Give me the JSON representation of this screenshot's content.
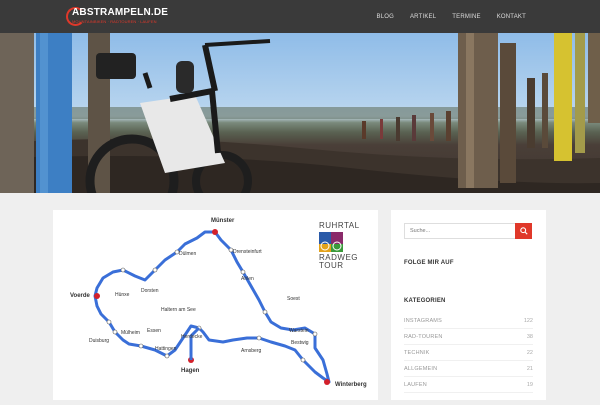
{
  "header": {
    "site_title": "ABSTRAMPELN.DE",
    "site_tagline": "MOUNTAINBIKEN · RADTOUREN · LAUFEN",
    "nav": [
      {
        "label": "BLOG"
      },
      {
        "label": "ARTIKEL"
      },
      {
        "label": "TERMINE"
      },
      {
        "label": "KONTAKT"
      }
    ]
  },
  "colors": {
    "accent": "#e0382a",
    "header_bg": "#3a3a3a",
    "page_bg": "#efefef",
    "route": "#3a6fd8"
  },
  "map": {
    "logo_lines": [
      "RUHRTAL",
      "RADWEG",
      "TOUR"
    ],
    "places": {
      "muenster": "Münster",
      "dolmen": "Dülmen",
      "drensteinfurt": "Drensteinfurt",
      "haltern": "Haltern am See",
      "ahlen": "Ahlen",
      "voerde": "Voerde",
      "huenxe": "Hünxe",
      "dorsten": "Dorsten",
      "soest": "Soest",
      "muelheim": "Mülheim",
      "essen": "Essen",
      "hattingen": "Hattingen",
      "herdecke": "Herdecke",
      "duisburg": "Duisburg",
      "warstein": "Warstein",
      "bestwig": "Bestwig",
      "arnsberg": "Arnsberg",
      "hagen": "Hagen",
      "winterberg": "Winterberg"
    }
  },
  "sidebar": {
    "search_placeholder": "Suche...",
    "follow_title": "FOLGE MIR AUF",
    "categories_title": "KATEGORIEN",
    "categories": [
      {
        "name": "INSTAGRAMS",
        "count": "122"
      },
      {
        "name": "RAD-TOUREN",
        "count": "38"
      },
      {
        "name": "TECHNIK",
        "count": "22"
      },
      {
        "name": "ALLGEMEIN",
        "count": "21"
      },
      {
        "name": "LAUFEN",
        "count": "19"
      }
    ]
  }
}
